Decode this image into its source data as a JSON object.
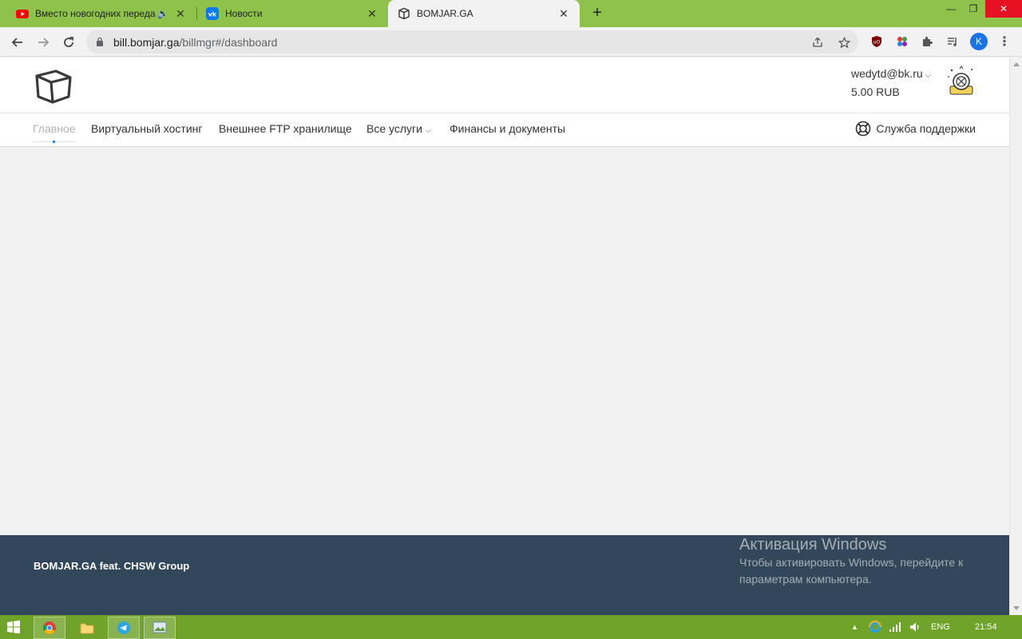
{
  "browser": {
    "tabs": [
      {
        "title": "Вместо новогодних переда",
        "icon": "youtube-icon",
        "audio": true
      },
      {
        "title": "Новости",
        "icon": "vk-icon"
      },
      {
        "title": "BOMJAR.GA",
        "icon": "cube-icon",
        "active": true
      }
    ],
    "url_host": "bill.bomjar.ga",
    "url_path": "/billmgr#/dashboard",
    "profile_initial": "K"
  },
  "site": {
    "user_email": "wedytd@bk.ru",
    "balance": "5.00 RUB",
    "nav": [
      {
        "label": "Главное",
        "active": true
      },
      {
        "label": "Виртуальный хостинг"
      },
      {
        "label": "Внешнее FTP хранилище"
      },
      {
        "label": "Все услуги",
        "dropdown": true
      },
      {
        "label": "Финансы и документы"
      }
    ],
    "support_label": "Служба поддержки",
    "footer_brand": "BOMJAR.GA feat. CHSW Group"
  },
  "watermark": {
    "title": "Активация Windows",
    "line1": "Чтобы активировать Windows, перейдите к",
    "line2": "параметрам компьютера."
  },
  "taskbar": {
    "lang": "ENG",
    "time": "21:54"
  },
  "colors": {
    "tabstrip": "#8fc24a",
    "footer": "#33475b",
    "taskbar": "#6fa32a",
    "accent": "#2b87d1"
  }
}
